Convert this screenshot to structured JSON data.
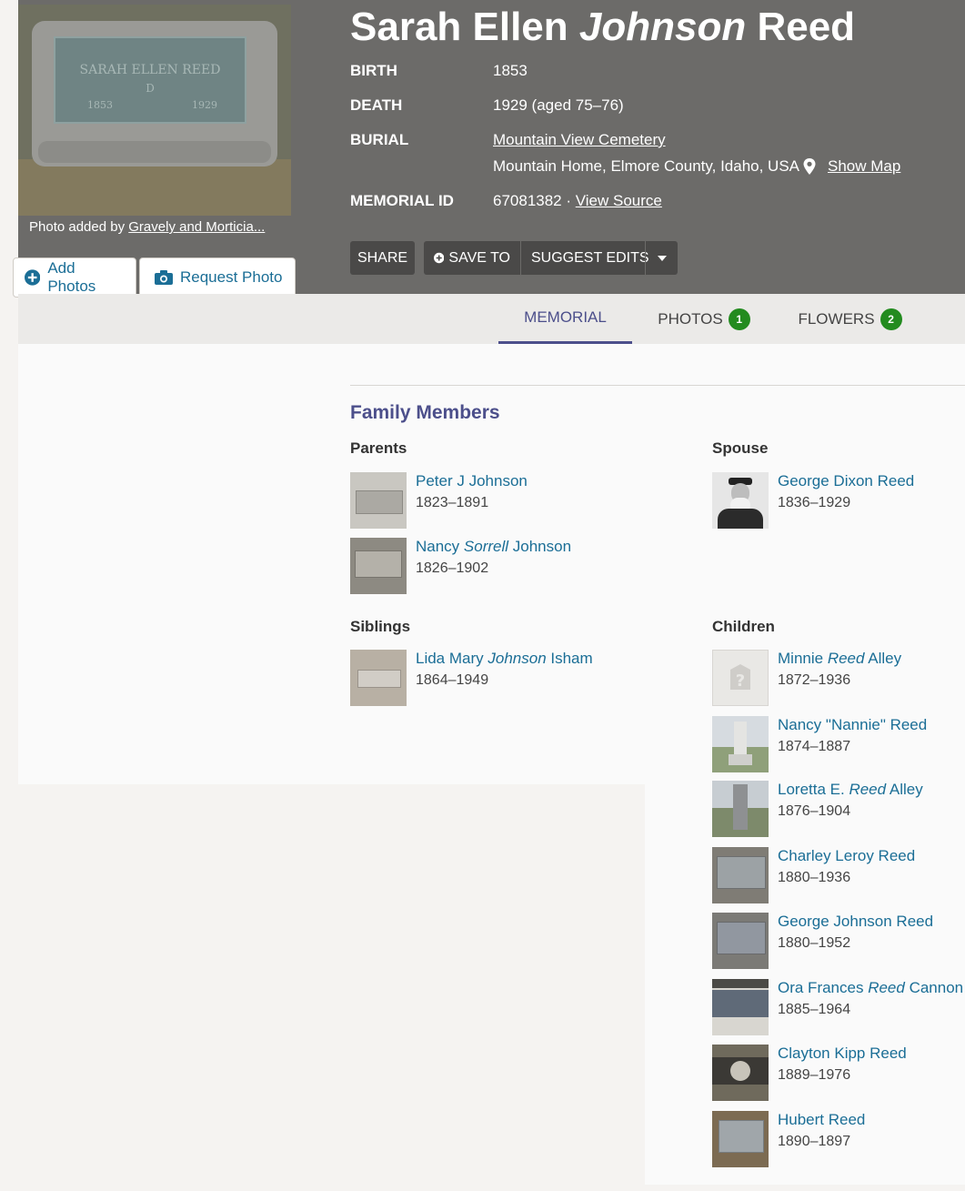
{
  "memorial": {
    "name_first": "Sarah Ellen ",
    "name_maiden": "Johnson",
    "name_last": " Reed",
    "facts": {
      "birth_label": "BIRTH",
      "birth_value": "1853",
      "death_label": "DEATH",
      "death_value": "1929 (aged 75–76)",
      "burial_label": "BURIAL",
      "burial_cemetery": "Mountain View Cemetery",
      "burial_location": "Mountain Home, Elmore County, Idaho, USA",
      "show_map": "Show Map",
      "memorial_id_label": "MEMORIAL ID",
      "memorial_id_value": "67081382",
      "id_separator": " · ",
      "view_source": "View Source"
    }
  },
  "photo": {
    "caption_prefix": "Photo added by ",
    "caption_author": "Gravely and Morticia...",
    "headstone_text": "SARAH ELLEN REED",
    "headstone_initial": "D",
    "headstone_year_left": "1853",
    "headstone_year_right": "1929"
  },
  "photo_actions": {
    "add_photos": "Add Photos",
    "request_photo": "Request Photo"
  },
  "actions": {
    "share": "SHARE",
    "save_to": "SAVE TO",
    "suggest_edits": "SUGGEST EDITS"
  },
  "tabs": {
    "memorial": "MEMORIAL",
    "photos": "PHOTOS",
    "photos_count": "1",
    "flowers": "FLOWERS",
    "flowers_count": "2"
  },
  "family": {
    "title": "Family Members",
    "parents_heading": "Parents",
    "spouse_heading": "Spouse",
    "siblings_heading": "Siblings",
    "children_heading": "Children",
    "parents": [
      {
        "first": "Peter J Johnson",
        "maiden": "",
        "last": "",
        "dates": "1823–1891"
      },
      {
        "first": "Nancy ",
        "maiden": "Sorrell",
        "last": " Johnson",
        "dates": "1826–1902"
      }
    ],
    "spouse": [
      {
        "first": "George Dixon Reed",
        "maiden": "",
        "last": "",
        "dates": "1836–1929"
      }
    ],
    "siblings": [
      {
        "first": "Lida Mary ",
        "maiden": "Johnson",
        "last": " Isham",
        "dates": "1864–1949"
      }
    ],
    "children": [
      {
        "first": "Minnie ",
        "maiden": "Reed",
        "last": " Alley",
        "dates": "1872–1936"
      },
      {
        "first": "Nancy \"Nannie\" Reed",
        "maiden": "",
        "last": "",
        "dates": "1874–1887"
      },
      {
        "first": "Loretta E. ",
        "maiden": "Reed",
        "last": " Alley",
        "dates": "1876–1904"
      },
      {
        "first": "Charley Leroy Reed",
        "maiden": "",
        "last": "",
        "dates": "1880–1936"
      },
      {
        "first": "George Johnson Reed",
        "maiden": "",
        "last": "",
        "dates": "1880–1952"
      },
      {
        "first": "Ora Frances ",
        "maiden": "Reed",
        "last": " Cannon",
        "dates": "1885–1964"
      },
      {
        "first": "Clayton Kipp Reed",
        "maiden": "",
        "last": "",
        "dates": "1889–1976"
      },
      {
        "first": "Hubert Reed",
        "maiden": "",
        "last": "",
        "dates": "1890–1897"
      }
    ]
  }
}
